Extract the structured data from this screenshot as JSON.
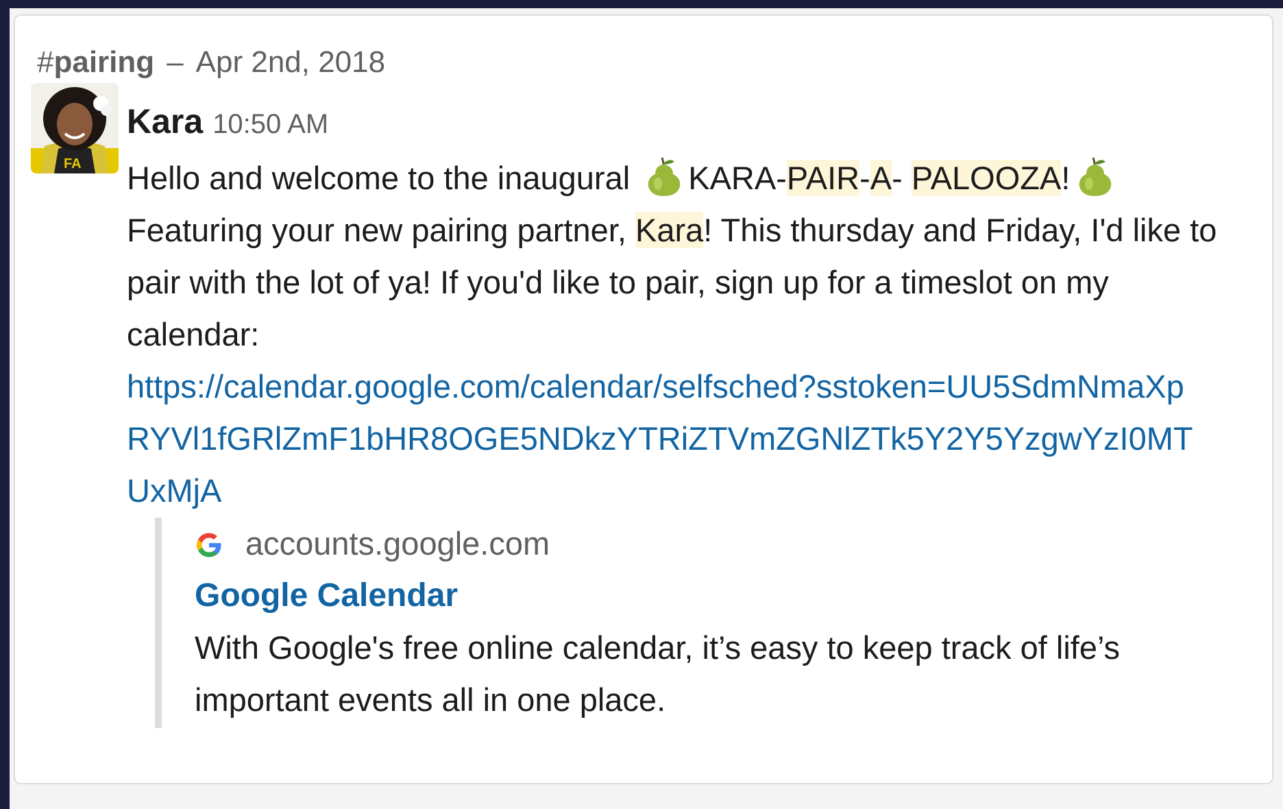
{
  "header": {
    "hash": "#",
    "channel": "pairing",
    "separator": "–",
    "date": "Apr 2nd, 2018"
  },
  "message": {
    "author": "Kara",
    "time": "10:50 AM",
    "avatar_icon": "user-avatar",
    "text": {
      "p1": "Hello and welcome to the inaugural",
      "p2": "KARA-",
      "hl1": "PAIR",
      "p3": "-",
      "hl2": "A",
      "p4": "-",
      "hl3": "PALOOZA",
      "p5": "!",
      "p6": "Featuring your new pairing partner,",
      "hl4": "Kara",
      "p7": "! This thursday and Friday, I'd like to pair with the lot of ya! If you'd like to pair, sign up for a timeslot on my calendar:"
    },
    "emoji": "pear-emoji",
    "link": "https://calendar.google.com/calendar/selfsched?sstoken=UU5SdmNmaXpRYVl1fGRlZmF1bHR8OGE5NDkzYTRiZTVmZGNlZTk5Y2Y5YzgwYzI0MTUxMjA"
  },
  "unfurl": {
    "icon": "google-icon",
    "source": "accounts.google.com",
    "title": "Google Calendar",
    "description": "With Google's free online calendar, it’s easy to keep track of life’s important events all in one place."
  },
  "colors": {
    "link": "#1264a3",
    "highlight": "#fdf6d9",
    "text": "#1d1c1d",
    "muted": "#616061",
    "frame": "#1b1d3a"
  }
}
